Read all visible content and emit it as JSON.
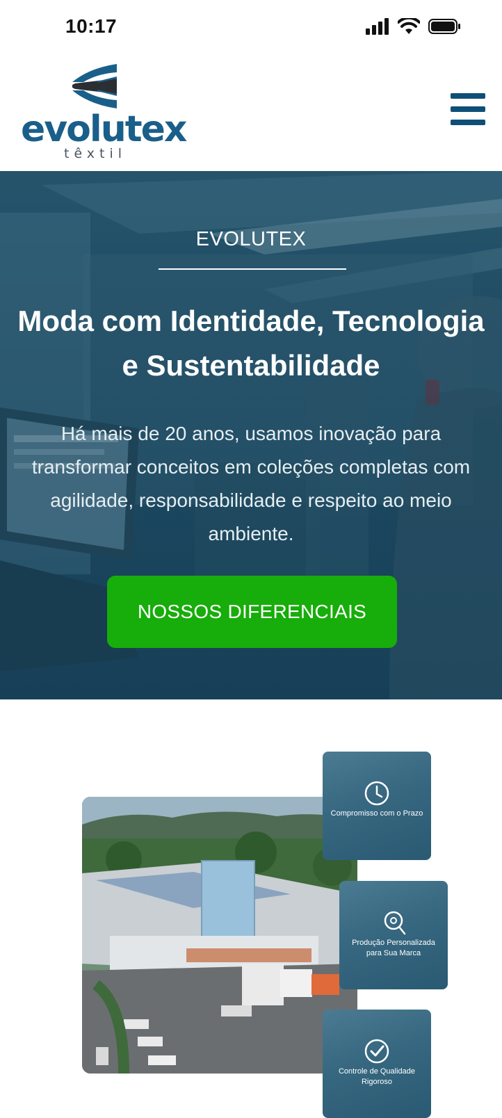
{
  "status_bar": {
    "time": "10:17",
    "icons": [
      "signal-icon",
      "wifi-icon",
      "battery-icon"
    ]
  },
  "header": {
    "logo": {
      "name": "evolutex",
      "tagline": "têxtil"
    },
    "menu_icon": "hamburger-menu-icon"
  },
  "hero": {
    "eyebrow": "EVOLUTEX",
    "title": "Moda com Identidade, Tecnologia e Sustentabilidade",
    "text": "Há mais de 20 anos, usamos inovação para transformar conceitos em coleções completas com agilidade, responsabilidade e respeito ao meio ambiente.",
    "cta_label": "NOSSOS DIFERENCIAIS"
  },
  "features": [
    {
      "icon": "clock-icon",
      "label": "Compromisso com o Prazo"
    },
    {
      "icon": "measuring-tape-icon",
      "label": "Produção Personalizada para Sua Marca"
    },
    {
      "icon": "check-badge-icon",
      "label": "Controle de Qualidade Rigoroso"
    }
  ],
  "colors": {
    "brand_blue": "#1a5f8a",
    "menu_blue": "#0e4f77",
    "cta_green": "#17ad0a",
    "hero_overlay": "#1f4c64"
  }
}
